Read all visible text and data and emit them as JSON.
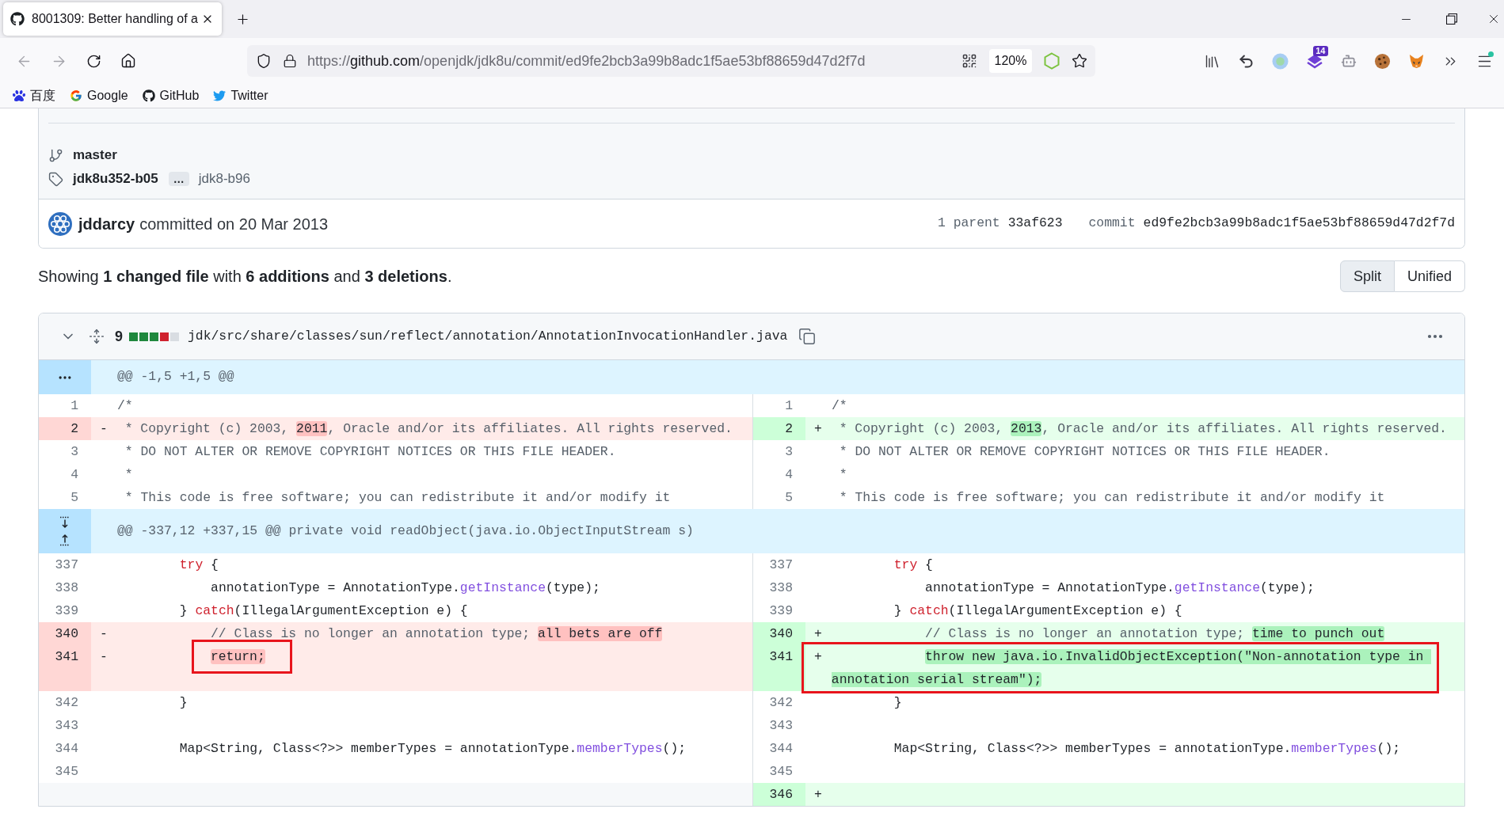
{
  "browser": {
    "tabs": [
      {
        "title": "8001309: Better handling of a",
        "selected": true
      }
    ],
    "address": {
      "scheme": "https://",
      "host": "github.com",
      "path": "/openjdk/jdk8u/commit/ed9fe2bcb3a99b8adc1f5ae53bf88659d47d2f7d"
    },
    "zoom": "120%",
    "extension_badge": "14",
    "bookmarks": [
      "百度",
      "Google",
      "GitHub",
      "Twitter"
    ]
  },
  "commit": {
    "branch": "master",
    "tags": {
      "first": "jdk8u352-b05",
      "more": "…",
      "last": "jdk8-b96"
    },
    "author": "jddarcy",
    "action": "committed on 20 Mar 2013",
    "parent_label": "1 parent",
    "parent": "33af623",
    "commit_label": "commit",
    "sha": "ed9fe2bcb3a99b8adc1f5ae53bf88659d47d2f7d"
  },
  "summary": "Showing **1 changed file** with **6 additions** and **3 deletions**.",
  "view_modes": [
    {
      "label": "Split",
      "selected": true
    },
    {
      "label": "Unified",
      "selected": false
    }
  ],
  "file": {
    "expanded": true,
    "changes": "9",
    "diffstat": [
      {
        "kind": "addition"
      },
      {
        "kind": "addition"
      },
      {
        "kind": "addition"
      },
      {
        "kind": "deletion"
      },
      {
        "kind": "neutral"
      }
    ],
    "path": "jdk/src/share/classes/sun/reflect/annotation/AnnotationInvocationHandler.java",
    "hunks": [
      {
        "header": "@@ -1,5 +1,5 @@",
        "kind": "dots",
        "rows": [
          {
            "left": {
              "kind": "context",
              "number": "1",
              "tokens": [
                {
                  "text": "/*",
                  "kind": "comment",
                  "changed": false
                }
              ]
            },
            "right": {
              "kind": "context",
              "number": "1",
              "tokens": [
                {
                  "text": "/*",
                  "kind": "comment",
                  "changed": false
                }
              ]
            }
          },
          {
            "left": {
              "kind": "deletion",
              "number": "2",
              "marker": "-",
              "tokens": [
                {
                  "text": " * Copyright (c) 2003, ",
                  "kind": "comment",
                  "changed": false
                },
                {
                  "text": "2011",
                  "kind": "comment",
                  "changed": true
                },
                {
                  "text": ", Oracle and/or its affiliates. All rights reserved.",
                  "kind": "comment",
                  "changed": false
                }
              ]
            },
            "right": {
              "kind": "addition",
              "number": "2",
              "marker": "+",
              "tokens": [
                {
                  "text": " * Copyright (c) 2003, ",
                  "kind": "comment",
                  "changed": false
                },
                {
                  "text": "2013",
                  "kind": "comment",
                  "changed": true
                },
                {
                  "text": ", Oracle and/or its affiliates. All rights reserved.",
                  "kind": "comment",
                  "changed": false
                }
              ]
            }
          },
          {
            "left": {
              "kind": "context",
              "number": "3",
              "tokens": [
                {
                  "text": " * DO NOT ALTER OR REMOVE COPYRIGHT NOTICES OR THIS FILE HEADER.",
                  "kind": "comment",
                  "changed": false
                }
              ]
            },
            "right": {
              "kind": "context",
              "number": "3",
              "tokens": [
                {
                  "text": " * DO NOT ALTER OR REMOVE COPYRIGHT NOTICES OR THIS FILE HEADER.",
                  "kind": "comment",
                  "changed": false
                }
              ]
            }
          },
          {
            "left": {
              "kind": "context",
              "number": "4",
              "tokens": [
                {
                  "text": " *",
                  "kind": "comment",
                  "changed": false
                }
              ]
            },
            "right": {
              "kind": "context",
              "number": "4",
              "tokens": [
                {
                  "text": " *",
                  "kind": "comment",
                  "changed": false
                }
              ]
            }
          },
          {
            "left": {
              "kind": "context",
              "number": "5",
              "tokens": [
                {
                  "text": " * This code is free software; you can redistribute it and/or modify it",
                  "kind": "comment",
                  "changed": false
                }
              ]
            },
            "right": {
              "kind": "context",
              "number": "5",
              "tokens": [
                {
                  "text": " * This code is free software; you can redistribute it and/or modify it",
                  "kind": "comment",
                  "changed": false
                }
              ]
            }
          }
        ]
      },
      {
        "header": "@@ -337,12 +337,15 @@ private void readObject(java.io.ObjectInputStream s)",
        "kind": "up-down",
        "rows": [
          {
            "left": {
              "kind": "context",
              "number": "337",
              "tokens": [
                {
                  "text": "        try",
                  "kind": "keyword",
                  "changed": false
                },
                {
                  "text": " {",
                  "kind": "plain",
                  "changed": false
                }
              ]
            },
            "right": {
              "kind": "context",
              "number": "337",
              "tokens": [
                {
                  "text": "        try",
                  "kind": "keyword",
                  "changed": false
                },
                {
                  "text": " {",
                  "kind": "plain",
                  "changed": false
                }
              ]
            }
          },
          {
            "left": {
              "kind": "context",
              "number": "338",
              "tokens": [
                {
                  "text": "            annotationType = AnnotationType.",
                  "kind": "plain",
                  "changed": false
                },
                {
                  "text": "getInstance",
                  "kind": "function",
                  "changed": false
                },
                {
                  "text": "(type);",
                  "kind": "plain",
                  "changed": false
                }
              ]
            },
            "right": {
              "kind": "context",
              "number": "338",
              "tokens": [
                {
                  "text": "            annotationType = AnnotationType.",
                  "kind": "plain",
                  "changed": false
                },
                {
                  "text": "getInstance",
                  "kind": "function",
                  "changed": false
                },
                {
                  "text": "(type);",
                  "kind": "plain",
                  "changed": false
                }
              ]
            }
          },
          {
            "left": {
              "kind": "context",
              "number": "339",
              "tokens": [
                {
                  "text": "        } ",
                  "kind": "plain",
                  "changed": false
                },
                {
                  "text": "catch",
                  "kind": "keyword",
                  "changed": false
                },
                {
                  "text": "(IllegalArgumentException e) {",
                  "kind": "plain",
                  "changed": false
                }
              ]
            },
            "right": {
              "kind": "context",
              "number": "339",
              "tokens": [
                {
                  "text": "        } ",
                  "kind": "plain",
                  "changed": false
                },
                {
                  "text": "catch",
                  "kind": "keyword",
                  "changed": false
                },
                {
                  "text": "(IllegalArgumentException e) {",
                  "kind": "plain",
                  "changed": false
                }
              ]
            }
          },
          {
            "left": {
              "kind": "deletion",
              "number": "340",
              "marker": "-",
              "tokens": [
                {
                  "text": "            // Class is no longer an annotation type; ",
                  "kind": "comment",
                  "changed": false
                },
                {
                  "text": "all bets are off",
                  "kind": "comment",
                  "changed": true
                }
              ]
            },
            "right": {
              "kind": "addition",
              "number": "340",
              "marker": "+",
              "tokens": [
                {
                  "text": "            // Class is no longer an annotation type; ",
                  "kind": "comment",
                  "changed": false
                },
                {
                  "text": "time to punch out",
                  "kind": "comment",
                  "changed": true
                }
              ]
            }
          },
          {
            "left": {
              "kind": "deletion",
              "number": "341",
              "marker": "-",
              "tokens": [
                {
                  "text": "            return;",
                  "kind": "plain",
                  "changed": true
                }
              ],
              "outline": {
                "kind": "text"
              }
            },
            "right": {
              "kind": "addition",
              "number": "341",
              "marker": "+",
              "tokens": [
                {
                  "text": "            throw new java.io.InvalidObjectException(\"Non-annotation type in annotation serial stream\");",
                  "kind": "plain",
                  "changed": true
                }
              ],
              "outline": {
                "kind": "cell"
              }
            }
          },
          {
            "left": {
              "kind": "context",
              "number": "342",
              "tokens": [
                {
                  "text": "        }",
                  "kind": "plain",
                  "changed": false
                }
              ]
            },
            "right": {
              "kind": "context",
              "number": "342",
              "tokens": [
                {
                  "text": "        }",
                  "kind": "plain",
                  "changed": false
                }
              ]
            }
          },
          {
            "left": {
              "kind": "context",
              "number": "343"
            },
            "right": {
              "kind": "context",
              "number": "343"
            }
          },
          {
            "left": {
              "kind": "context",
              "number": "344",
              "tokens": [
                {
                  "text": "        Map<String, Class<?>> memberTypes = annotationType.",
                  "kind": "plain",
                  "changed": false
                },
                {
                  "text": "memberTypes",
                  "kind": "function",
                  "changed": false
                },
                {
                  "text": "();",
                  "kind": "plain",
                  "changed": false
                }
              ]
            },
            "right": {
              "kind": "context",
              "number": "344",
              "tokens": [
                {
                  "text": "        Map<String, Class<?>> memberTypes = annotationType.",
                  "kind": "plain",
                  "changed": false
                },
                {
                  "text": "memberTypes",
                  "kind": "function",
                  "changed": false
                },
                {
                  "text": "();",
                  "kind": "plain",
                  "changed": false
                }
              ]
            }
          },
          {
            "left": {
              "kind": "context",
              "number": "345"
            },
            "right": {
              "kind": "context",
              "number": "345"
            }
          },
          {
            "left": {
              "kind": "empty"
            },
            "right": {
              "kind": "addition",
              "number": "346",
              "marker": "+"
            }
          }
        ]
      }
    ]
  }
}
